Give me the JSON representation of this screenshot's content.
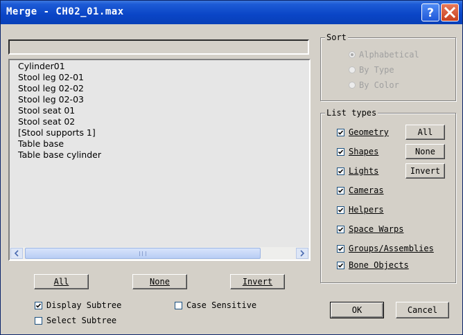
{
  "window": {
    "title": "Merge - CH02_01.max"
  },
  "titlebar": {
    "help_icon": "help-icon",
    "close_icon": "close-icon"
  },
  "objects": {
    "items": [
      "Cylinder01",
      "Stool leg 02-01",
      "Stool leg 02-02",
      "Stool leg 02-03",
      "Stool seat 01",
      "Stool seat 02",
      "[Stool supports 1]",
      "Table base",
      "Table base cylinder"
    ]
  },
  "list_buttons": {
    "all": "All",
    "none": "None",
    "invert": "Invert"
  },
  "options": {
    "display_subtree": "Display Subtree",
    "select_subtree": "Select Subtree",
    "case_sensitive": "Case Sensitive"
  },
  "sort": {
    "title": "Sort",
    "alphabetical": "Alphabetical",
    "by_type": "By Type",
    "by_color": "By Color",
    "selected": "Alphabetical"
  },
  "list_types": {
    "title": "List types",
    "geometry": "Geometry",
    "shapes": "Shapes",
    "lights": "Lights",
    "cameras": "Cameras",
    "helpers": "Helpers",
    "space_warps": "Space Warps",
    "groups": "Groups/Assemblies",
    "bone_objects": "Bone Objects",
    "all": "All",
    "none": "None",
    "invert": "Invert"
  },
  "dialog_buttons": {
    "ok": "OK",
    "cancel": "Cancel"
  }
}
